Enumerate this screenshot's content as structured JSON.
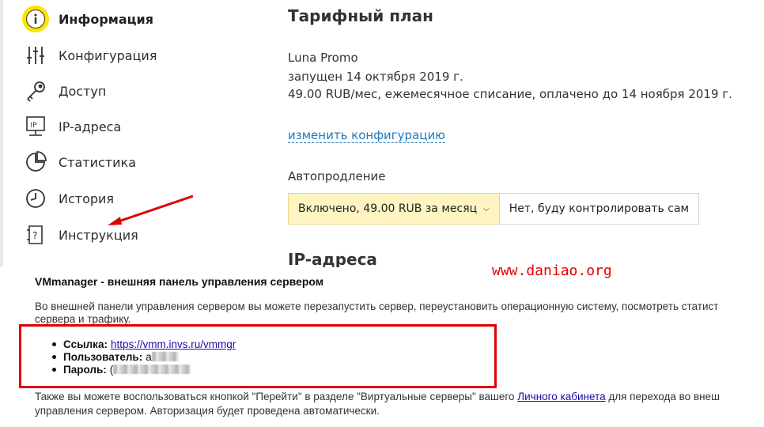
{
  "sidebar": {
    "items": [
      {
        "label": "Информация",
        "icon": "info-icon",
        "active": true
      },
      {
        "label": "Конфигурация",
        "icon": "sliders-icon"
      },
      {
        "label": "Доступ",
        "icon": "key-icon"
      },
      {
        "label": "IP-адреса",
        "icon": "ip-monitor-icon"
      },
      {
        "label": "Статистика",
        "icon": "pie-chart-icon"
      },
      {
        "label": "История",
        "icon": "clock-icon"
      },
      {
        "label": "Инструкция",
        "icon": "help-doc-icon"
      }
    ]
  },
  "plan": {
    "title": "Тарифный план",
    "name": "Luna Promo",
    "started": "запущен 14 октября 2019 г.",
    "price": "49.00 RUB/мес, ежемесячное списание, оплачено до 14 ноября 2019 г.",
    "change_link": "изменить конфигурацию",
    "autorenew_label": "Автопродление",
    "autorenew_on": "Включено, 49.00 RUB за месяц",
    "autorenew_off": "Нет, буду контролировать сам",
    "ip_heading": "IP-адреса"
  },
  "watermark": "www.daniao.org",
  "email": {
    "title": "VMmanager - внешняя панель управления сервером",
    "para1_line1": "Во внешней панели управления сервером вы можете перезапустить сервер, переустановить операционную систему, посмотреть статист",
    "para1_line2": "сервера и трафику.",
    "link_label": "Ссылка:",
    "link_url": "https://vmm.invs.ru/vmmgr",
    "user_label": "Пользователь:",
    "user_value_prefix": "a",
    "pass_label": "Пароль:",
    "pass_value_prefix": "(",
    "para2_line1_a": "Также вы можете воспользоваться кнопкой \"Перейти\" в разделе \"Виртуальные серверы\" вашего",
    "para2_link": "Личного кабинета",
    "para2_line1_b": "для перехода во внеш",
    "para2_line2": "управления сервером. Авторизация будет проведена автоматически."
  },
  "colors": {
    "accent_yellow": "#ffe400",
    "link_blue": "#1f7ab8",
    "annotation_red": "#e00000"
  }
}
